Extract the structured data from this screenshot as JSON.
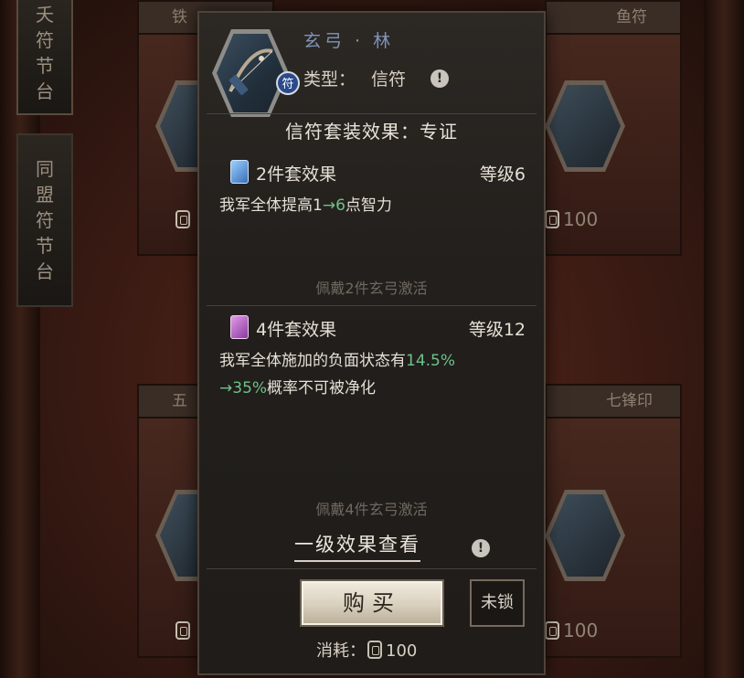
{
  "background": {
    "side_tabs": [
      {
        "chars": [
          "夭",
          "符",
          "节",
          "台"
        ]
      },
      {
        "chars": [
          "同",
          "盟",
          "符",
          "节",
          "台"
        ]
      }
    ],
    "card_headers": [
      "铁",
      "鱼符",
      "五",
      "七锋印"
    ],
    "card_costs": [
      "100",
      "100",
      "100"
    ]
  },
  "item": {
    "name": "玄弓 · 林",
    "type_label": "类型：",
    "type_value": "信符",
    "type_badge": "符",
    "info_icon": "!"
  },
  "set": {
    "title": "信符套装效果：专证",
    "tiers": [
      {
        "gem": "blue-gem-icon",
        "title": "2件套效果",
        "level": "等级6",
        "desc_prefix": "我军全体提高",
        "desc_from": "1",
        "desc_arrow": "→",
        "desc_to": "6",
        "desc_suffix": "点智力",
        "hint": "佩戴2件玄弓激活"
      },
      {
        "gem": "purple-gem-icon",
        "title": "4件套效果",
        "level": "等级12",
        "desc_prefix": "我军全体施加的负面状态有",
        "desc_from": "14.5%",
        "desc_arrow": "→",
        "desc_to": "35%",
        "desc_suffix": "概率不可被净化",
        "hint": "佩戴4件玄弓激活"
      }
    ]
  },
  "level_link": "一级效果查看",
  "level_info_icon": "!",
  "buttons": {
    "buy": "购买",
    "lock": "未锁"
  },
  "cost": {
    "label": "消耗：",
    "amount": "100"
  },
  "colors": {
    "highlight_green": "#6ec28a",
    "name_blue": "#7f95b8"
  }
}
